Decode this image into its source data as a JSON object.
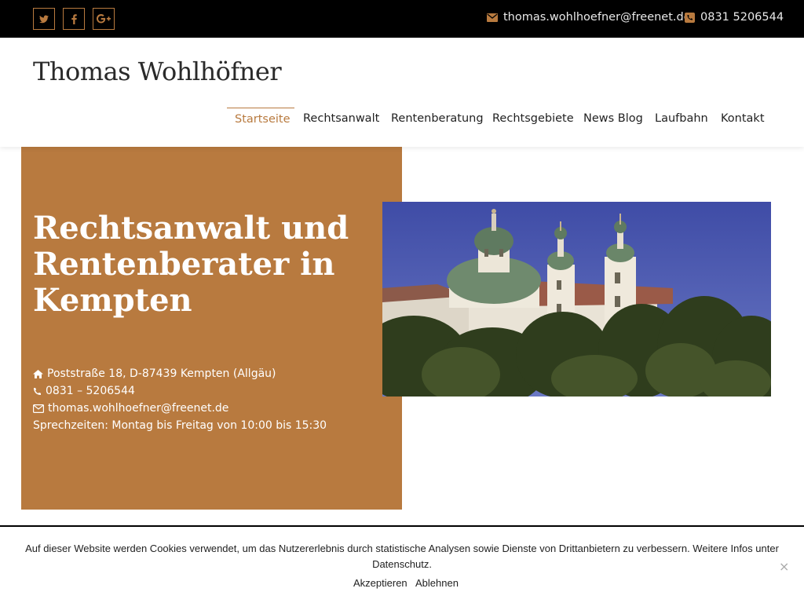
{
  "topbar": {
    "social": [
      {
        "name": "twitter-icon"
      },
      {
        "name": "facebook-icon"
      },
      {
        "name": "google-plus-icon"
      }
    ],
    "email": "thomas.wohlhoefner@freenet.de",
    "phone": "0831 5206544"
  },
  "header": {
    "site_title": "Thomas Wohlhöfner",
    "nav": [
      "Startseite",
      "Rechtsanwalt",
      "Rentenberatung",
      "Rechtsgebiete",
      "News Blog",
      "Laufbahn",
      "Kontakt"
    ],
    "active_nav": "Startseite"
  },
  "hero": {
    "title": "Rechtsanwalt und Rentenberater in Kempten",
    "address": "Poststraße 18, D-87439 Kempten (Allgäu)",
    "phone": "0831 – 5206544",
    "email": "thomas.wohlhoefner@freenet.de",
    "hours": "Sprechzeiten: Montag bis Freitag von 10:00 bis 15:30"
  },
  "cookie": {
    "text": "Auf dieser Website werden Cookies verwendet, um das Nutzererlebnis durch statistische Analysen sowie Dienste von Drittanbietern zu verbessern. Weitere Infos unter Datenschutz.",
    "accept": "Akzeptieren",
    "decline": "Ablehnen",
    "close": "×"
  },
  "colors": {
    "accent": "#b87a3f",
    "topbar_bg": "#000000"
  }
}
